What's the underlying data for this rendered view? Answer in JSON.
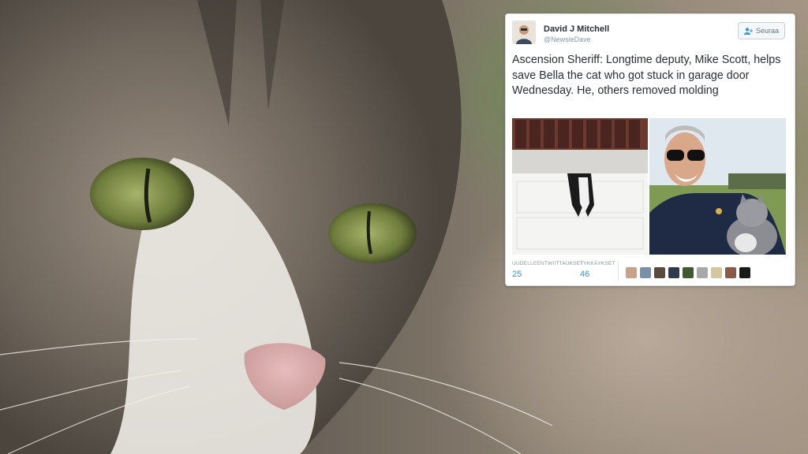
{
  "tweet": {
    "display_name": "David J Mitchell",
    "handle": "@NewsieDave",
    "follow_label": "Seuraa",
    "text": "Ascension Sheriff: Longtime deputy, Mike Scott, helps save Bella the cat who got stuck in garage door Wednesday. He, others removed molding",
    "retweets_label": "UUDELLEENTWIITTAUKSET",
    "retweets_count": "25",
    "likes_label": "TYKKÄYKSET",
    "likes_count": "46"
  },
  "colors": {
    "link": "#3b94d9",
    "text": "#292f33",
    "muted": "#8899a6"
  },
  "icons": [
    "follow-user-icon"
  ]
}
